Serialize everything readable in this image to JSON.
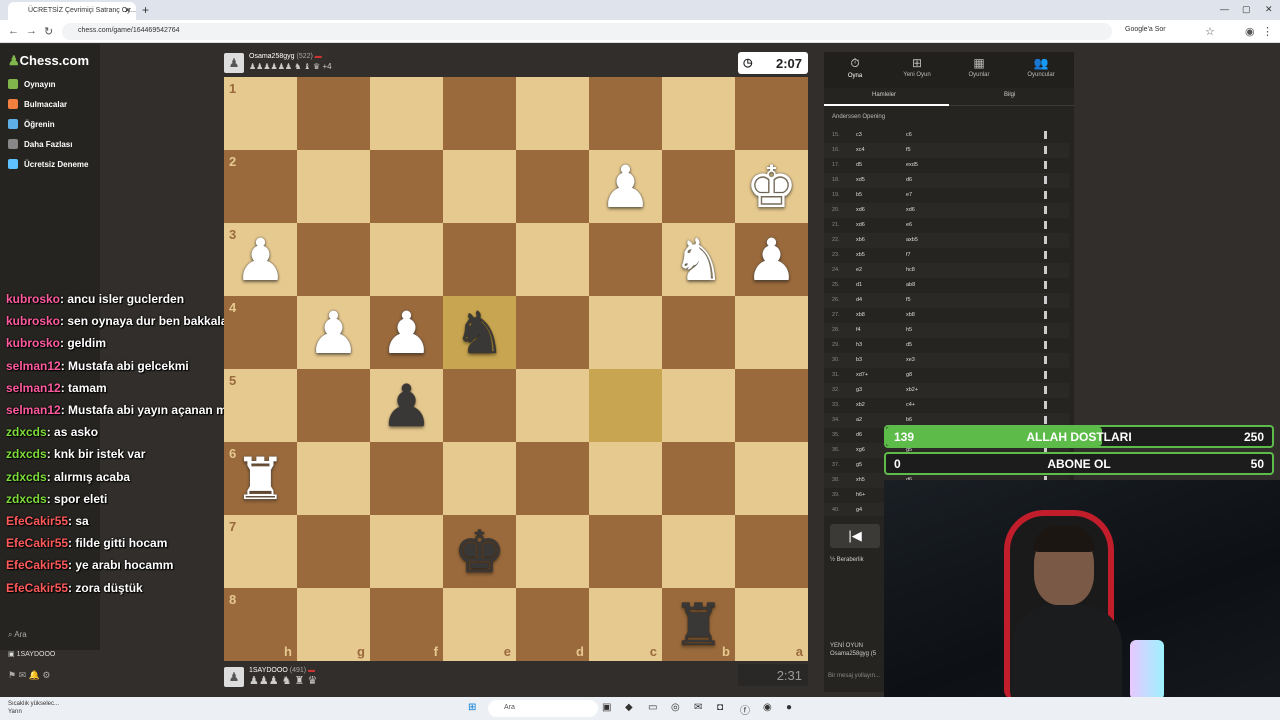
{
  "browser": {
    "tab_title": "ÜCRETSİZ Çevrimiçi Satranç Oy...",
    "url": "chess.com/game/164469542764",
    "google_btn": "Google'a Sor"
  },
  "sidebar": {
    "logo": "Chess.com",
    "items": [
      {
        "label": "Oynayın",
        "color": "#81b64c"
      },
      {
        "label": "Bulmacalar",
        "color": "#f27f3d"
      },
      {
        "label": "Öğrenin",
        "color": "#5dafe5"
      },
      {
        "label": "Daha Fazlası",
        "color": "#888888"
      },
      {
        "label": "Ücretsiz Deneme",
        "color": "#5dc2ff"
      }
    ],
    "search": "Ara",
    "user": "1SAYDOOO"
  },
  "chat": [
    {
      "user": "kubrosko",
      "text": ": ancu isler guclerden",
      "color": "#ff5a9e"
    },
    {
      "user": "kubrosko",
      "text": ": sen oynaya dur ben bakkala gidip geliyorum",
      "color": "#ff5a9e"
    },
    {
      "user": "kubrosko",
      "text": ": geldim",
      "color": "#ff5a9e"
    },
    {
      "user": "selman12",
      "text": ": Mustafa abi gelcekmi",
      "color": "#ff5a9e"
    },
    {
      "user": "selman12",
      "text": ": tamam",
      "color": "#ff5a9e"
    },
    {
      "user": "selman12",
      "text": ": Mustafa abi yayın açanan mı sonra",
      "color": "#ff5a9e"
    },
    {
      "user": "zdxcds",
      "text": ": as asko",
      "color": "#7ddc3a"
    },
    {
      "user": "zdxcds",
      "text": ": knk bir istek var",
      "color": "#7ddc3a"
    },
    {
      "user": "zdxcds",
      "text": ": alırmış acaba",
      "color": "#7ddc3a"
    },
    {
      "user": "zdxcds",
      "text": ": spor eleti",
      "color": "#7ddc3a"
    },
    {
      "user": "EfeCakir55",
      "text": ": sa",
      "color": "#ff5a5a"
    },
    {
      "user": "EfeCakir55",
      "text": ": filde gitti hocam",
      "color": "#ff5a5a"
    },
    {
      "user": "EfeCakir55",
      "text": ": ye arabı hocamm",
      "color": "#ff5a5a"
    },
    {
      "user": "EfeCakir55",
      "text": ": zora düştük",
      "color": "#ff5a5a"
    }
  ],
  "top_player": {
    "name": "Osama258gyg",
    "rating": "(522)",
    "captured": "♟♟♟♟♟♟ ♞ ♝ ♛",
    "plus": "+4",
    "clock": "2:07"
  },
  "bottom_player": {
    "name": "1SAYDOOO",
    "rating": "(491)",
    "captured": "♟♟♟ ♞ ♜ ♛",
    "clock": "2:31"
  },
  "board": {
    "light": "#e6c98f",
    "dark": "#9a6a3c",
    "highlight_light": "#c8a550",
    "highlight_dark": "#c8a550",
    "ranks": [
      "1",
      "2",
      "3",
      "4",
      "5",
      "6",
      "7",
      "8"
    ],
    "files": [
      "h",
      "g",
      "f",
      "e",
      "d",
      "c",
      "b",
      "a"
    ],
    "highlight": [
      [
        3,
        3
      ],
      [
        4,
        5
      ]
    ],
    "pieces": [
      {
        "p": "♚",
        "c": "w",
        "r": 1,
        "f": 7
      },
      {
        "p": "♟",
        "c": "w",
        "r": 1,
        "f": 5
      },
      {
        "p": "♟",
        "c": "w",
        "r": 2,
        "f": 0
      },
      {
        "p": "♞",
        "c": "w",
        "r": 2,
        "f": 6
      },
      {
        "p": "♟",
        "c": "w",
        "r": 2,
        "f": 7
      },
      {
        "p": "♟",
        "c": "w",
        "r": 3,
        "f": 1
      },
      {
        "p": "♟",
        "c": "w",
        "r": 3,
        "f": 2
      },
      {
        "p": "♞",
        "c": "b",
        "r": 3,
        "f": 3
      },
      {
        "p": "♟",
        "c": "b",
        "r": 4,
        "f": 2
      },
      {
        "p": "♜",
        "c": "w",
        "r": 5,
        "f": 0
      },
      {
        "p": "♚",
        "c": "b",
        "r": 6,
        "f": 3
      },
      {
        "p": "♜",
        "c": "b",
        "r": 7,
        "f": 6
      }
    ]
  },
  "panel": {
    "tabs": [
      {
        "icon": "⏱",
        "label": "Oyna"
      },
      {
        "icon": "⊞",
        "label": "Yeni Oyun"
      },
      {
        "icon": "▦",
        "label": "Oyunlar"
      },
      {
        "icon": "👥",
        "label": "Oyuncular"
      }
    ],
    "subtabs": [
      "Hamleler",
      "Bilgi"
    ],
    "opening": "Anderssen Opening",
    "moves": [
      {
        "n": "15.",
        "w": "c3",
        "b": "c6"
      },
      {
        "n": "16.",
        "w": "xc4",
        "b": "f5"
      },
      {
        "n": "17.",
        "w": "d5",
        "b": "exd5"
      },
      {
        "n": "18.",
        "w": "xd5",
        "b": "d6"
      },
      {
        "n": "19.",
        "w": "b5",
        "b": "e7"
      },
      {
        "n": "20.",
        "w": "xd6",
        "b": "xd6"
      },
      {
        "n": "21.",
        "w": "xd6",
        "b": "e6"
      },
      {
        "n": "22.",
        "w": "xb6",
        "b": "axb5"
      },
      {
        "n": "23.",
        "w": "xb5",
        "b": "f7"
      },
      {
        "n": "24.",
        "w": "e2",
        "b": "hc8"
      },
      {
        "n": "25.",
        "w": "d1",
        "b": "ab8"
      },
      {
        "n": "26.",
        "w": "d4",
        "b": "f5"
      },
      {
        "n": "27.",
        "w": "xb8",
        "b": "xb8"
      },
      {
        "n": "28.",
        "w": "f4",
        "b": "h5"
      },
      {
        "n": "29.",
        "w": "h3",
        "b": "d5"
      },
      {
        "n": "30.",
        "w": "b3",
        "b": "xe3"
      },
      {
        "n": "31.",
        "w": "xd7+",
        "b": "g8"
      },
      {
        "n": "32.",
        "w": "g3",
        "b": "xb2+"
      },
      {
        "n": "33.",
        "w": "xb2",
        "b": "c4+"
      },
      {
        "n": "34.",
        "w": "a2",
        "b": "b6"
      },
      {
        "n": "35.",
        "w": "d6",
        "b": "a1"
      },
      {
        "n": "36.",
        "w": "xg6",
        "b": "g5"
      },
      {
        "n": "37.",
        "w": "g5",
        "b": "f6"
      },
      {
        "n": "38.",
        "w": "xh5",
        "b": "d6"
      },
      {
        "n": "39.",
        "w": "h6+",
        "b": "e7"
      },
      {
        "n": "40.",
        "w": "g4",
        "b": ""
      }
    ],
    "draw": "Beraberlik",
    "new_game": "YENİ OYUN",
    "new_game_player": "Osama258gyg (5",
    "message_placeholder": "Bir mesaj yollayın..."
  },
  "poll": {
    "rows": [
      {
        "left": "139",
        "label": "ALLAH DOSTLARI",
        "right": "250",
        "fill": 0.56,
        "color": "#5dbb4a"
      },
      {
        "left": "0",
        "label": "ABONE OL",
        "right": "50",
        "fill": 0.0,
        "color": "#5dbb4a"
      }
    ]
  },
  "taskbar": {
    "weather": "Sıcaklık yükselec...",
    "weather_sub": "Yarın",
    "search": "Ara"
  }
}
